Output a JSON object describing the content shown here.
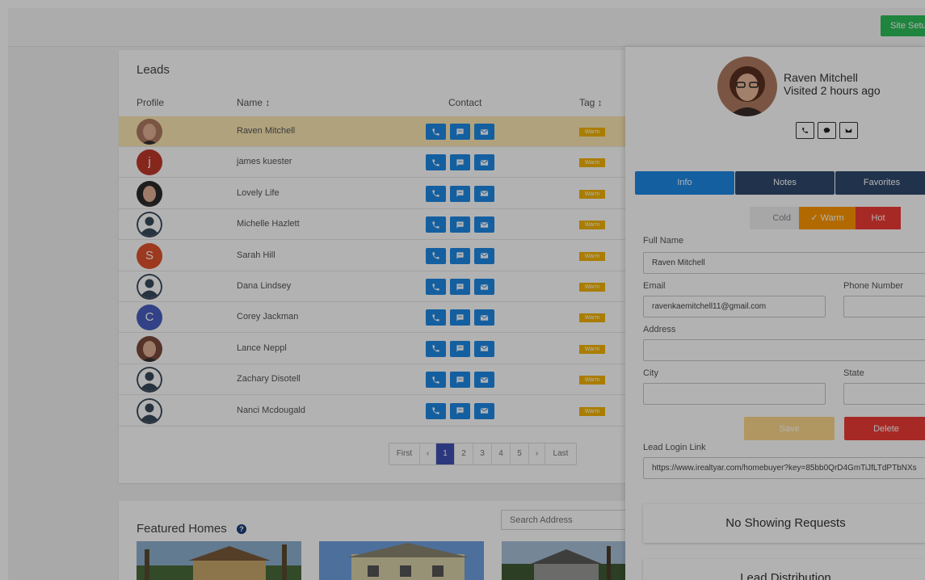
{
  "topbar": {
    "site_setup_label": "Site Setup"
  },
  "leads": {
    "title": "Leads",
    "columns": {
      "profile": "Profile",
      "name": "Name ↕",
      "contact": "Contact",
      "tag": "Tag ↕"
    },
    "rows": [
      {
        "name": "Raven Mitchell",
        "tag": "Warm",
        "avatar_letter": ""
      },
      {
        "name": "james kuester",
        "tag": "Warm",
        "avatar_letter": "j"
      },
      {
        "name": "Lovely Life",
        "tag": "Warm",
        "avatar_letter": ""
      },
      {
        "name": "Michelle Hazlett",
        "tag": "Warm",
        "avatar_letter": ""
      },
      {
        "name": "Sarah Hill",
        "tag": "Warm",
        "avatar_letter": "S"
      },
      {
        "name": "Dana Lindsey",
        "tag": "Warm",
        "avatar_letter": ""
      },
      {
        "name": "Corey Jackman",
        "tag": "Warm",
        "avatar_letter": "C"
      },
      {
        "name": "Lance Neppl",
        "tag": "Warm",
        "avatar_letter": ""
      },
      {
        "name": "Zachary Disotell",
        "tag": "Warm",
        "avatar_letter": ""
      },
      {
        "name": "Nanci Mcdougald",
        "tag": "Warm",
        "avatar_letter": ""
      }
    ],
    "pagination": {
      "first": "First",
      "prev": "‹",
      "pages": [
        "1",
        "2",
        "3",
        "4",
        "5"
      ],
      "next": "›",
      "last": "Last",
      "active": "1"
    }
  },
  "featured": {
    "title": "Featured Homes",
    "help": "?",
    "search_placeholder": "Search Address"
  },
  "panel": {
    "name": "Raven Mitchell",
    "visited": "Visited 2 hours ago",
    "tabs": {
      "info": "Info",
      "notes": "Notes",
      "favorites": "Favorites"
    },
    "temperature": {
      "cold": "Cold",
      "warm": "✓ Warm",
      "hot": "Hot",
      "selected": "Warm"
    },
    "form": {
      "full_name_label": "Full Name",
      "full_name": "Raven Mitchell",
      "email_label": "Email",
      "email": "ravenkaemitchell11@gmail.com",
      "phone_label": "Phone Number",
      "phone": "",
      "address_label": "Address",
      "address": "",
      "city_label": "City",
      "city": "",
      "state_label": "State",
      "state": ""
    },
    "save_label": "Save",
    "delete_label": "Delete",
    "login_link_label": "Lead Login Link",
    "login_link": "https://www.irealtyar.com/homebuyer?key=85bb0QrD4GmTiJfLTdPTbNXs",
    "no_showing": "No Showing Requests",
    "lead_distribution": "Lead Distribution"
  },
  "colors": {
    "primary_blue": "#1e88e5",
    "warm": "#ff9800",
    "hot": "#ef3b36",
    "navy": "#304a6e",
    "green": "#2dbd5a"
  }
}
